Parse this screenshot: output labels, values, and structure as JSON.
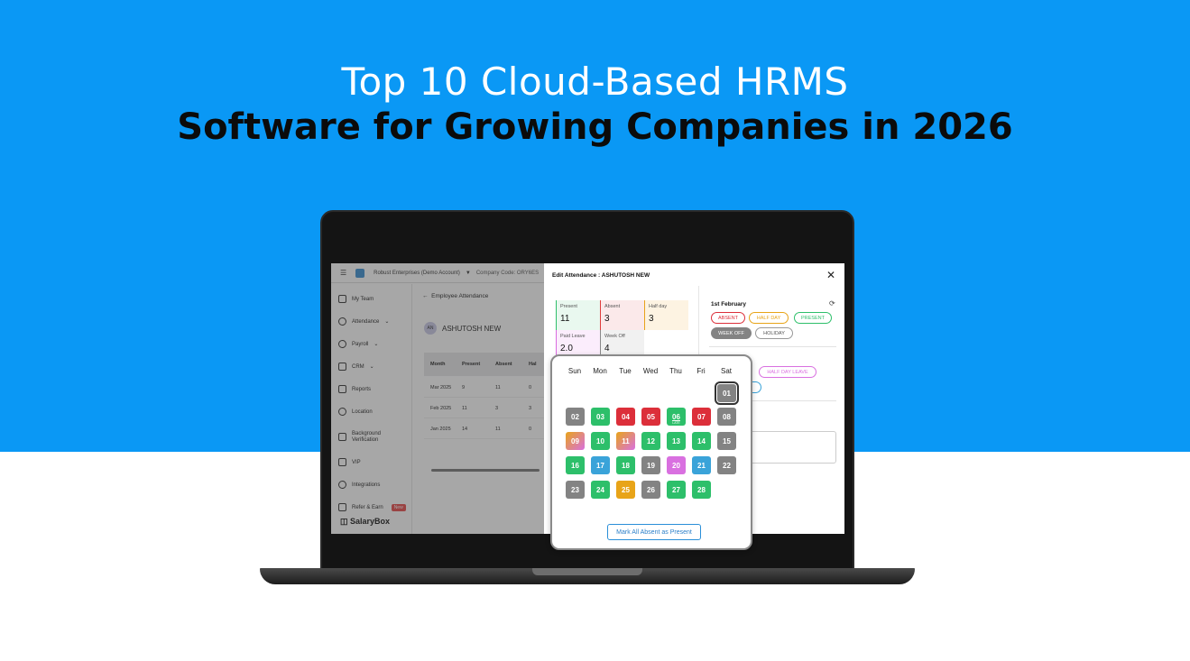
{
  "headline": {
    "line1": "Top 10 Cloud-Based HRMS",
    "line2": "Software for Growing Companies in 2026"
  },
  "app": {
    "company": "Robust Enterprises (Demo Account)",
    "company_code": "Company Code: ORY6ES",
    "sidebar": [
      {
        "label": "My Team",
        "icon": "team-icon"
      },
      {
        "label": "Attendance",
        "icon": "attendance-icon",
        "has_dropdown": true
      },
      {
        "label": "Payroll",
        "icon": "payroll-icon",
        "has_dropdown": true
      },
      {
        "label": "CRM",
        "icon": "crm-icon",
        "has_dropdown": true
      },
      {
        "label": "Reports",
        "icon": "reports-icon"
      },
      {
        "label": "Location",
        "icon": "location-icon"
      },
      {
        "label": "Background Verification",
        "icon": "verification-icon"
      },
      {
        "label": "VIP",
        "icon": "vip-icon"
      },
      {
        "label": "Integrations",
        "icon": "integrations-icon"
      },
      {
        "label": "Refer & Earn",
        "icon": "gift-icon",
        "badge": "New"
      }
    ],
    "brand": "SalaryBox",
    "main": {
      "breadcrumb": "Employee Attendance",
      "avatar": "AN",
      "employee_name": "ASHUTOSH NEW",
      "columns": [
        "Month",
        "Present",
        "Absent",
        "Hal"
      ],
      "rows": [
        [
          "Mar 2025",
          "9",
          "11",
          "0"
        ],
        [
          "Feb 2025",
          "11",
          "3",
          "3"
        ],
        [
          "Jan 2025",
          "14",
          "11",
          "0"
        ]
      ]
    }
  },
  "edit_panel": {
    "title": "Edit Attendance : ASHUTOSH NEW",
    "stats": [
      {
        "label": "Present",
        "value": "11",
        "color": "#2fbf6b"
      },
      {
        "label": "Absent",
        "value": "3",
        "color": "#e03c3c"
      },
      {
        "label": "Half day",
        "value": "3",
        "color": "#e8a21a"
      },
      {
        "label": "Paid Leave",
        "value": "2.0",
        "color": "#d96be0"
      },
      {
        "label": "Week Off",
        "value": "4",
        "color": "#888888"
      }
    ],
    "selected_date": "1st February",
    "status_pills": [
      "ABSENT",
      "HALF DAY",
      "PRESENT",
      "WEEK OFF",
      "HOLIDAY"
    ],
    "leave_pill": "HALF DAY LEAVE"
  },
  "calendar": {
    "weekdays": [
      "Sun",
      "Mon",
      "Tue",
      "Wed",
      "Thu",
      "Fri",
      "Sat"
    ],
    "days": [
      {
        "d": "01",
        "status": "weekoff-selected"
      },
      {
        "d": "02",
        "status": "weekoff"
      },
      {
        "d": "03",
        "status": "present"
      },
      {
        "d": "04",
        "status": "absent"
      },
      {
        "d": "05",
        "status": "absent"
      },
      {
        "d": "06",
        "status": "present",
        "note": "LATE"
      },
      {
        "d": "07",
        "status": "absent"
      },
      {
        "d": "08",
        "status": "weekoff"
      },
      {
        "d": "09",
        "status": "halfday-leave"
      },
      {
        "d": "10",
        "status": "present"
      },
      {
        "d": "11",
        "status": "halfday-leave"
      },
      {
        "d": "12",
        "status": "present"
      },
      {
        "d": "13",
        "status": "present"
      },
      {
        "d": "14",
        "status": "present"
      },
      {
        "d": "15",
        "status": "weekoff"
      },
      {
        "d": "16",
        "status": "present"
      },
      {
        "d": "17",
        "status": "holiday"
      },
      {
        "d": "18",
        "status": "present"
      },
      {
        "d": "19",
        "status": "weekoff"
      },
      {
        "d": "20",
        "status": "leave"
      },
      {
        "d": "21",
        "status": "holiday"
      },
      {
        "d": "22",
        "status": "weekoff"
      },
      {
        "d": "23",
        "status": "weekoff"
      },
      {
        "d": "24",
        "status": "present"
      },
      {
        "d": "25",
        "status": "halfday"
      },
      {
        "d": "26",
        "status": "weekoff"
      },
      {
        "d": "27",
        "status": "present"
      },
      {
        "d": "28",
        "status": "present"
      }
    ],
    "colors": {
      "present": "#2dbf6a",
      "absent": "#dc2f3a",
      "weekoff": "#838383",
      "halfday": "#e8a418",
      "holiday": "#3aa3d9",
      "leave": "#d970e0"
    },
    "button_label": "Mark All Absent as Present"
  }
}
